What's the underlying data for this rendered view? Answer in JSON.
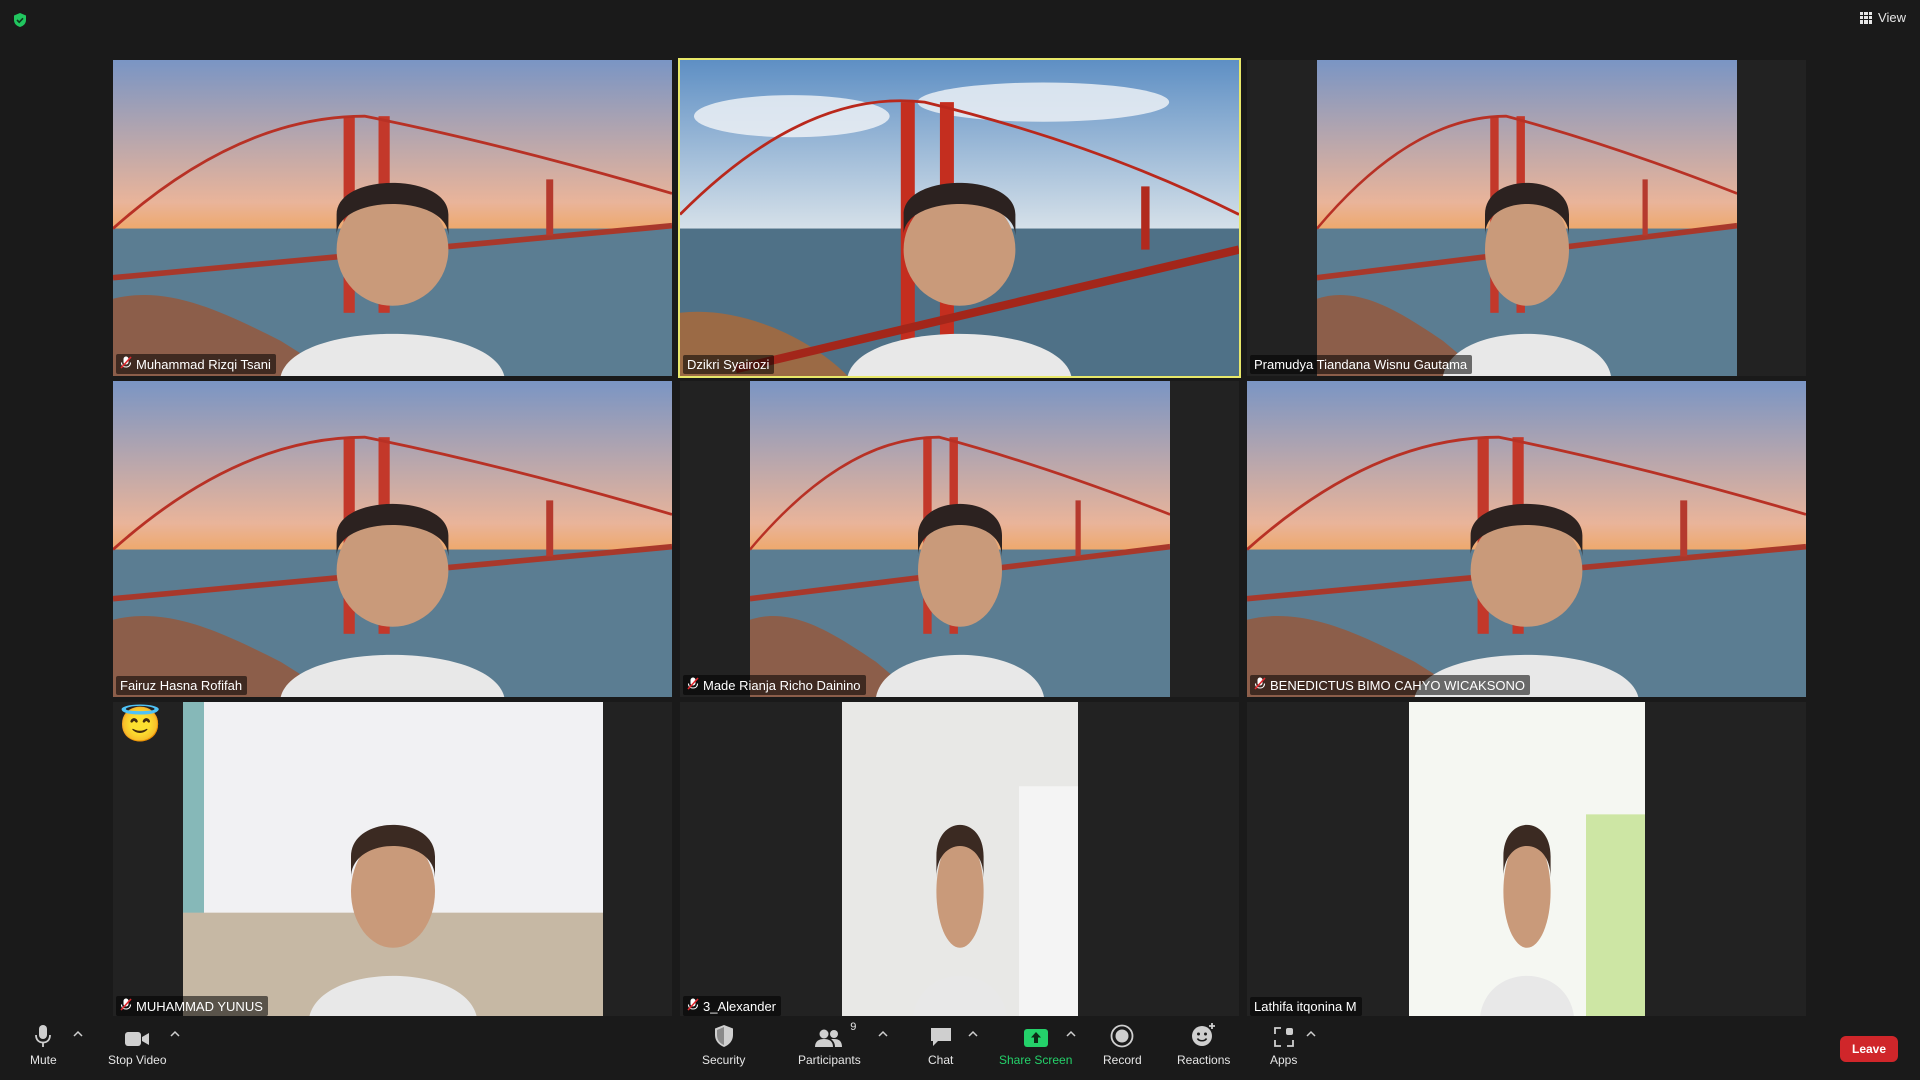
{
  "header": {
    "view_label": "View"
  },
  "participants": [
    {
      "name": "Muhammad Rizqi Tsani",
      "muted": true,
      "background": "bridge-sunset",
      "video_fit": "full",
      "active": false
    },
    {
      "name": "Dzikri Syairozi",
      "muted": false,
      "background": "bridge-day",
      "video_fit": "full",
      "active": true
    },
    {
      "name": "Pramudya Tiandana Wisnu Gautama",
      "muted": false,
      "background": "bridge-sunset",
      "video_fit": "narrow",
      "active": false
    },
    {
      "name": "Fairuz Hasna Rofifah",
      "muted": false,
      "background": "bridge-sunset",
      "video_fit": "full",
      "active": false
    },
    {
      "name": "Made Rianja Richo Dainino",
      "muted": true,
      "background": "bridge-sunset",
      "video_fit": "narrow",
      "active": false
    },
    {
      "name": "BENEDICTUS BIMO CAHYO WICAKSONO",
      "muted": true,
      "background": "bridge-sunset",
      "video_fit": "full",
      "active": false
    },
    {
      "name": "MUHAMMAD YUNUS",
      "muted": true,
      "background": "room-white",
      "video_fit": "narrow",
      "active": false,
      "reaction_icon": "smiling-face-with-halo-icon",
      "reaction": "😇"
    },
    {
      "name": "3_Alexander",
      "muted": true,
      "background": "room-grey",
      "video_fit": "portrait",
      "active": false
    },
    {
      "name": "Lathifa itqonina M",
      "muted": false,
      "background": "room-bright",
      "video_fit": "portrait",
      "active": false
    }
  ],
  "toolbar": {
    "mute_label": "Mute",
    "stop_video_label": "Stop Video",
    "security_label": "Security",
    "participants_label": "Participants",
    "participants_count": "9",
    "chat_label": "Chat",
    "share_screen_label": "Share Screen",
    "record_label": "Record",
    "reactions_label": "Reactions",
    "apps_label": "Apps",
    "leave_label": "Leave"
  },
  "colors": {
    "background": "#1a1a1a",
    "active_speaker_border": "#e8e86a",
    "share_green": "#24d16a",
    "leave_red": "#d0262a",
    "security_shield": "#21c65f"
  }
}
